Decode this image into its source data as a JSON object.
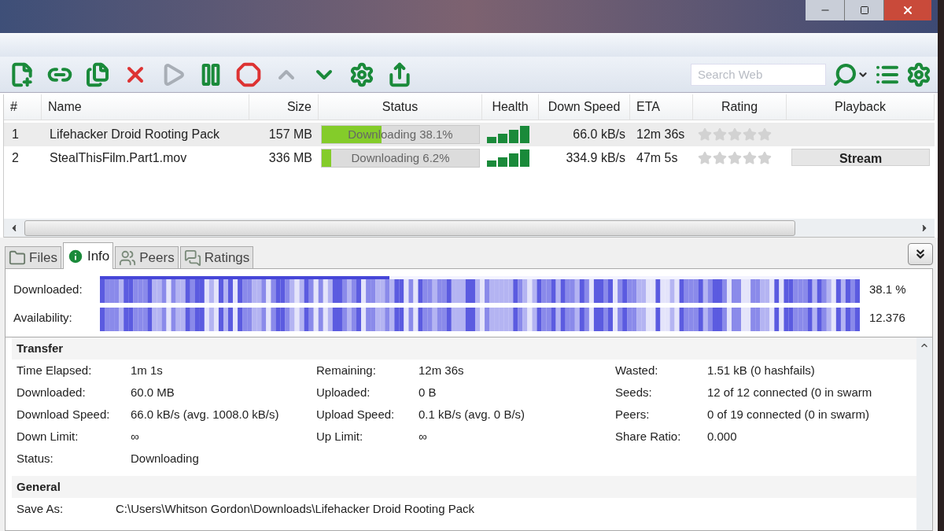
{
  "toolbar": [
    {
      "kind": "add-file",
      "disabled": false
    },
    {
      "kind": "add-link",
      "disabled": false
    },
    {
      "kind": "create",
      "disabled": false
    },
    {
      "kind": "remove",
      "disabled": false
    },
    {
      "kind": "start",
      "disabled": true
    },
    {
      "kind": "pause",
      "disabled": false
    },
    {
      "kind": "stop",
      "disabled": false
    },
    {
      "kind": "up",
      "disabled": true
    },
    {
      "kind": "down",
      "disabled": false
    },
    {
      "kind": "settings",
      "disabled": false
    },
    {
      "kind": "share",
      "disabled": false
    }
  ],
  "search": {
    "placeholder": "Search Web"
  },
  "table": {
    "columns": [
      "#",
      "Name",
      "Size",
      "Status",
      "Health",
      "Down Speed",
      "ETA",
      "Rating",
      "Playback"
    ],
    "rows": [
      {
        "index": "1",
        "name": "Lifehacker Droid Rooting Pack",
        "size": "157 MB",
        "status": "Downloading 38.1%",
        "level": 0.381,
        "down_speed": "66.0 kB/s",
        "eta": "12m 36s",
        "stars": 0,
        "selected": true
      },
      {
        "index": "2",
        "name": "StealThisFilm.Part1.mov",
        "size": "336 MB",
        "status": "Downloading 6.2%",
        "level": 0.062,
        "down_speed": "334.9 kB/s",
        "eta": "47m 5s",
        "stars": 0,
        "selected": false,
        "playback": "Stream"
      }
    ]
  },
  "tabs": [
    {
      "label": "Files",
      "kind": "files",
      "selected": false
    },
    {
      "label": "Info",
      "kind": "info",
      "selected": true
    },
    {
      "label": "Peers",
      "kind": "peers",
      "selected": false
    },
    {
      "label": "Ratings",
      "kind": "ratings",
      "selected": false
    }
  ],
  "pieces": {
    "downloaded_label": "Downloaded:",
    "level": 0.381,
    "downloaded_reading": "38.1 %",
    "availability_label": "Availability:",
    "availability_reading": "12.376"
  },
  "transfer": {
    "title": "Transfer",
    "rows": [
      [
        [
          "Time Elapsed:",
          "1m 1s"
        ],
        [
          "Remaining:",
          "12m 36s"
        ],
        [
          "Wasted:",
          "1.51 kB (0 hashfails)"
        ]
      ],
      [
        [
          "Downloaded:",
          "60.0 MB"
        ],
        [
          "Uploaded:",
          "0 B"
        ],
        [
          "Seeds:",
          "12 of 12 connected (0 in swarm"
        ]
      ],
      [
        [
          "Download Speed:",
          "66.0 kB/s (avg. 1008.0 kB/s)"
        ],
        [
          "Upload Speed:",
          "0.1 kB/s (avg. 0 B/s)"
        ],
        [
          "Peers:",
          "0 of 19 connected (0 in swarm)"
        ]
      ],
      [
        [
          "Down Limit:",
          "∞"
        ],
        [
          "Up Limit:",
          "∞"
        ],
        [
          "Share Ratio:",
          "0.000"
        ]
      ],
      [
        [
          "Status:",
          "Downloading"
        ]
      ]
    ]
  },
  "general": {
    "title": "General",
    "rows": [
      [
        "Save As:",
        "C:\\Users\\Whitson Gordon\\Downloads\\Lifehacker Droid Rooting Pack"
      ]
    ]
  }
}
